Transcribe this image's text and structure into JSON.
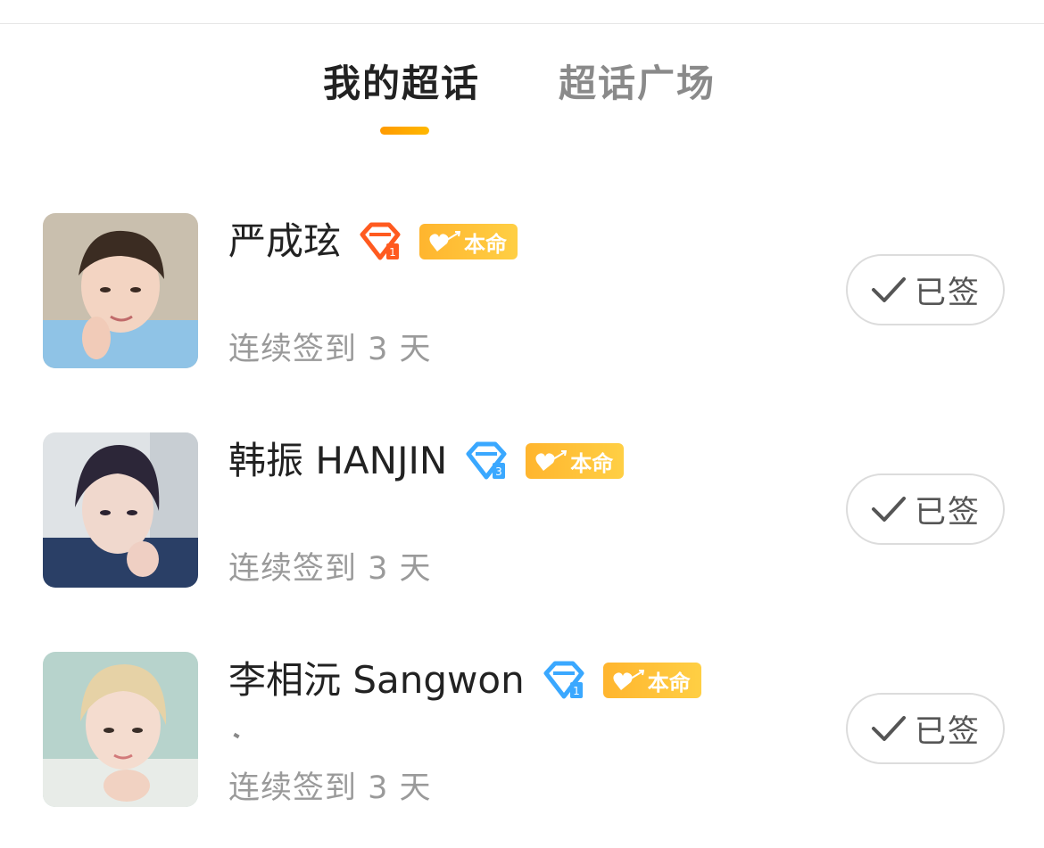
{
  "tabs": [
    {
      "label": "我的超话",
      "active": true
    },
    {
      "label": "超话广场",
      "active": false
    }
  ],
  "accent_color": "#ff9f00",
  "topics": [
    {
      "name": "严成玹",
      "gem_icon": "red-gem-level-icon",
      "gem_color": "#ff5a1f",
      "badge_label": "本命",
      "streak": "连续签到 3 天",
      "signed_label": "已签"
    },
    {
      "name": "韩振 HANJIN",
      "gem_icon": "blue-gem-level-icon",
      "gem_color": "#3aa8ff",
      "badge_label": "本命",
      "streak": "连续签到 3 天",
      "signed_label": "已签"
    },
    {
      "name": "李相沅 Sangwon",
      "gem_icon": "blue-gem-level-icon",
      "gem_color": "#3aa8ff",
      "badge_label": "本命",
      "streak": "连续签到 3 天",
      "signed_label": "已签"
    }
  ]
}
